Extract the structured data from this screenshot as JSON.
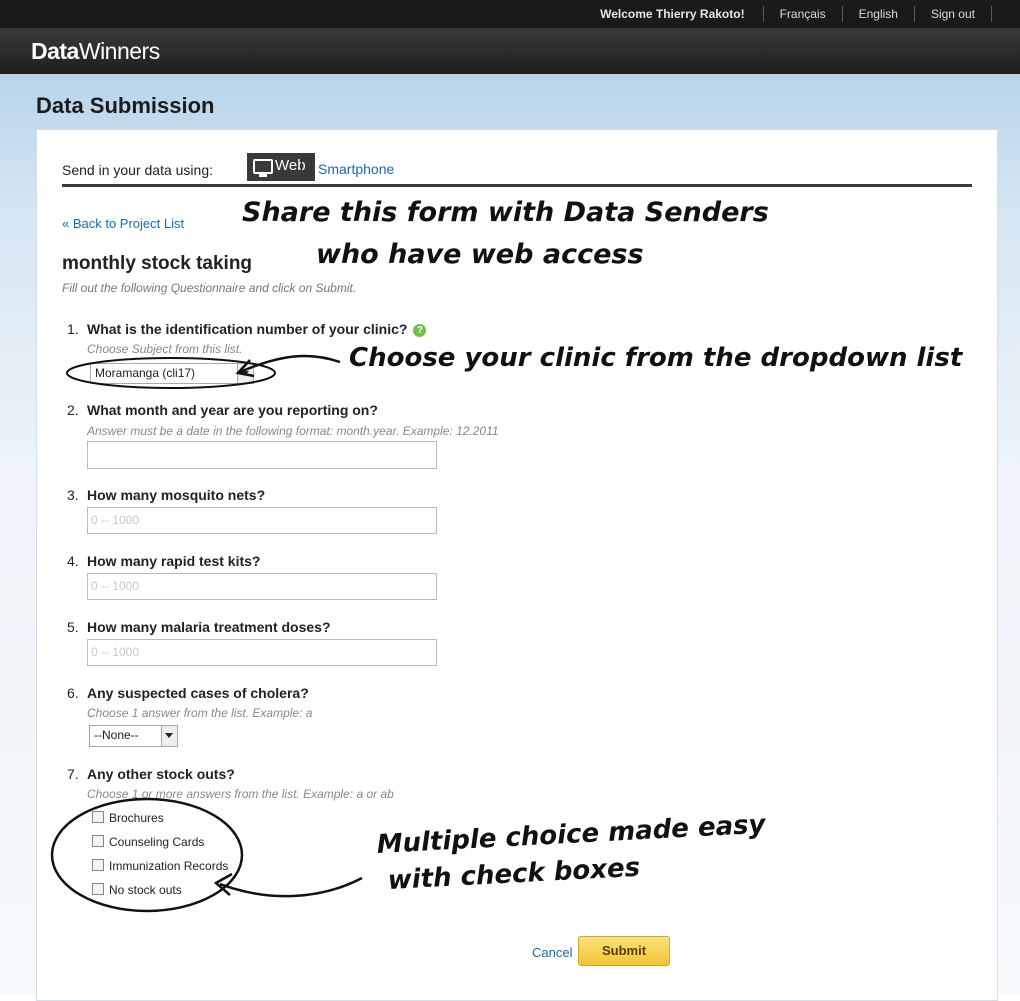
{
  "topbar": {
    "welcome": "Welcome Thierry Rakoto!",
    "links": [
      "Français",
      "English",
      "Sign out"
    ]
  },
  "brand": {
    "logo_bold": "Data",
    "logo_rest": "Winners"
  },
  "page": {
    "title": "Data Submission"
  },
  "send": {
    "label": "Send in your data using:",
    "web_label": "Web",
    "smartphone_label": "Smartphone"
  },
  "back_link": "« Back to Project List",
  "form": {
    "title": "monthly stock taking",
    "hint": "Fill out the following Questionnaire and click on Submit.",
    "questions": [
      {
        "num": "1.",
        "text": "What is the identification number of your clinic?",
        "instruction": "Choose Subject from this list.",
        "value": "Moramanga (cli17)"
      },
      {
        "num": "2.",
        "text": "What month and year are you reporting on?",
        "instruction": "Answer must be a date in the following format: month.year. Example: 12.2011",
        "placeholder": ""
      },
      {
        "num": "3.",
        "text": "How many mosquito nets?",
        "placeholder": "0 -- 1000"
      },
      {
        "num": "4.",
        "text": "How many rapid test kits?",
        "placeholder": "0 -- 1000"
      },
      {
        "num": "5.",
        "text": "How many malaria treatment doses?",
        "placeholder": "0 -- 1000"
      },
      {
        "num": "6.",
        "text": "Any suspected cases of cholera?",
        "instruction": "Choose 1 answer from the list. Example: a",
        "value": "--None--"
      },
      {
        "num": "7.",
        "text": "Any other stock outs?",
        "instruction": "Choose 1 or more answers from the list. Example: a or ab",
        "options": [
          "Brochures",
          "Counseling Cards",
          "Immunization Records",
          "No stock outs"
        ]
      }
    ],
    "cancel": "Cancel",
    "submit": "Submit"
  },
  "annotations": {
    "share_line1": "Share this form with Data Senders",
    "share_line2": "who have web access",
    "choose": "Choose your clinic from the dropdown list",
    "multi_line1": "Multiple choice made easy",
    "multi_line2": "with check boxes"
  },
  "colors": {
    "link": "#1a6ab0",
    "submit": "#f1c437",
    "topbar": "#1a1a1a"
  }
}
